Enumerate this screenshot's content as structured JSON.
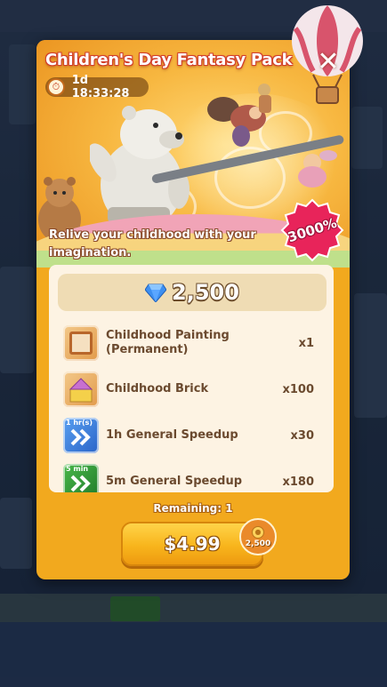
{
  "pack": {
    "title": "Children's Day Fantasy Pack",
    "timer": "1d 18:33:28",
    "description": "Relive your childhood with your imagination.",
    "value_badge": "3000%",
    "gems": "2,500",
    "items": [
      {
        "name": "Childhood Painting (Permanent)",
        "qty": "x1",
        "icon": "painting-frame-icon"
      },
      {
        "name": "Childhood Brick",
        "qty": "x100",
        "icon": "brick-icon"
      },
      {
        "name": "1h General Speedup",
        "qty": "x30",
        "icon": "speedup-icon",
        "tag": "1 hr(s)"
      },
      {
        "name": "5m General Speedup",
        "qty": "x180",
        "icon": "speedup-icon",
        "tag": "5 min"
      }
    ],
    "remaining": "Remaining: 1",
    "price": "$4.99",
    "bonus_coins": "2,500"
  },
  "colors": {
    "card": "#f2a91e",
    "title_outline": "#d23f2c",
    "badge": "#e8245a",
    "panel": "#fdf3e3",
    "item_text": "#6b4a2f"
  }
}
